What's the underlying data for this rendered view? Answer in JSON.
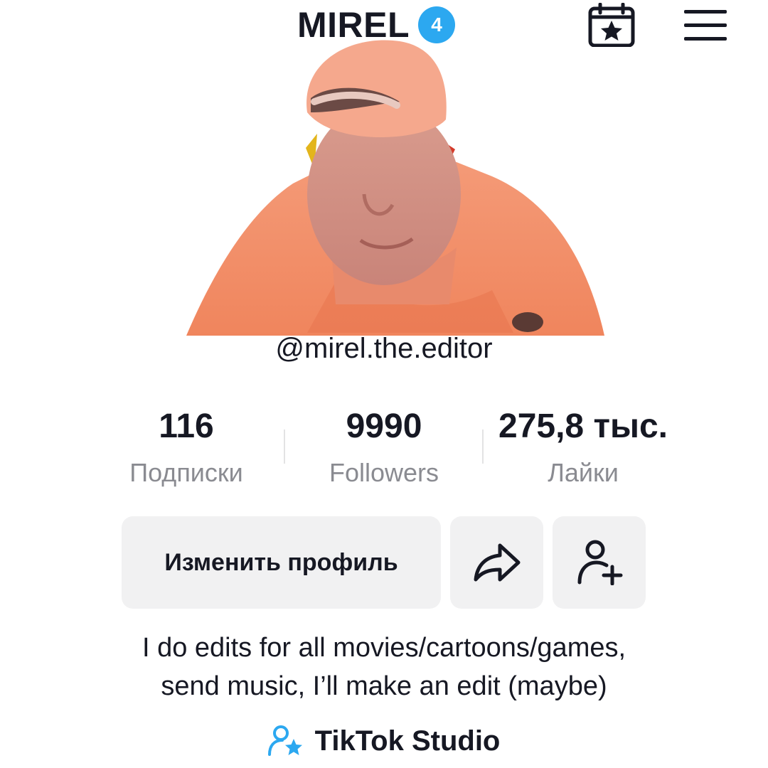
{
  "header": {
    "title": "MIREL",
    "notification_count": "4",
    "calendar_icon": "calendar-star-icon",
    "menu_icon": "hamburger-menu-icon",
    "badge_color": "#2ca8f0"
  },
  "profile": {
    "username": "@mirel.the.editor",
    "avatar": "avatar-cutout-person-orange"
  },
  "stats": [
    {
      "value": "116",
      "label": "Подписки"
    },
    {
      "value": "9990",
      "label": "Followers"
    },
    {
      "value": "275,8 тыс.",
      "label": "Лайки"
    }
  ],
  "actions": {
    "edit_profile_label": "Изменить профиль",
    "share_icon": "share-arrow-icon",
    "add_friend_icon": "add-friend-icon"
  },
  "bio": {
    "line1": "I do edits for all movies/cartoons/games,",
    "line2": "send music, I’ll make an edit (maybe)"
  },
  "studio": {
    "label": "TikTok Studio",
    "icon": "creator-star-icon",
    "icon_color": "#2ca8f0"
  }
}
